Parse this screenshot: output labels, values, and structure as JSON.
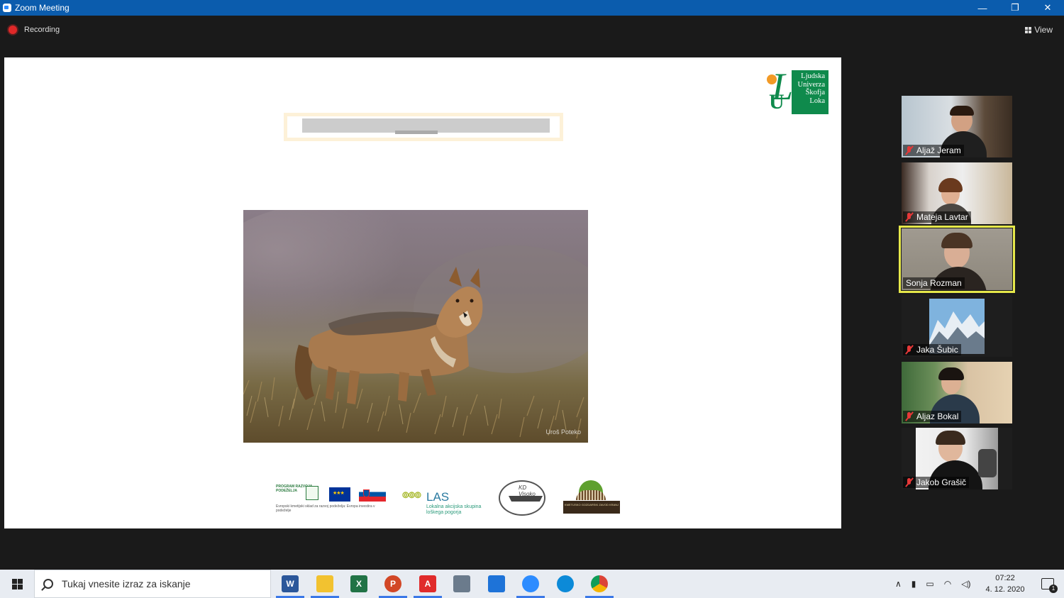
{
  "window": {
    "title": "Zoom Meeting",
    "controls": [
      "minimize-icon",
      "maximize-icon",
      "close-icon"
    ]
  },
  "meeting": {
    "recording_label": "Recording",
    "view_label": "View"
  },
  "slide": {
    "university_logo_lines": [
      "Ljudska",
      "Univerza",
      "Škofja",
      "Loka"
    ],
    "photo_credit": "Uroš Poteko",
    "partner_logos": [
      {
        "name": "program-razvoja-podezelja-logo",
        "text": "PROGRAM RAZVOJA PODEŽELJA"
      },
      {
        "name": "program-razvoja-subtitle",
        "text": "Evropski kmetijski sklad za razvoj podeželja: Evropa investira v podeželje"
      },
      {
        "name": "las-logo",
        "text": "LAS"
      },
      {
        "name": "las-subtitle",
        "text": "Lokalna akcijska skupina loškega pogorja"
      },
      {
        "name": "kd-logo",
        "text": "KD Visoko"
      },
      {
        "name": "kgz-logo",
        "text": "KMETIJSKO GOZDARSKI ZAVOD KRANJ"
      }
    ]
  },
  "participants": [
    {
      "name": "Aljaž Jeram",
      "muted": true,
      "active": false
    },
    {
      "name": "Mateja Lavtar",
      "muted": true,
      "active": false
    },
    {
      "name": "Sonja Rozman",
      "muted": false,
      "active": true
    },
    {
      "name": "Jaka Šubic",
      "muted": true,
      "active": false
    },
    {
      "name": "Aljaz Bokal",
      "muted": true,
      "active": false
    },
    {
      "name": "Jakob Grašič",
      "muted": true,
      "active": false
    }
  ],
  "taskbar": {
    "search_placeholder": "Tukaj vnesite izraz za iskanje",
    "apps": [
      {
        "name": "word-icon",
        "letter": "W",
        "color": "#2b579a"
      },
      {
        "name": "file-explorer-icon",
        "letter": "",
        "color": "#f2c230"
      },
      {
        "name": "excel-icon",
        "letter": "X",
        "color": "#217346"
      },
      {
        "name": "powerpoint-icon",
        "letter": "P",
        "color": "#d24726"
      },
      {
        "name": "acrobat-icon",
        "letter": "A",
        "color": "#e02b2b"
      },
      {
        "name": "calculator-icon",
        "letter": "",
        "color": "#6b7b8c"
      },
      {
        "name": "calendar-icon",
        "letter": "",
        "color": "#1e73d8"
      },
      {
        "name": "zoom-icon",
        "letter": "",
        "color": "#2d8cff"
      },
      {
        "name": "edge-icon",
        "letter": "",
        "color": "#0c8ad8"
      },
      {
        "name": "chrome-icon",
        "letter": "",
        "color": "#db4437"
      }
    ],
    "time": "07:22",
    "date": "4. 12. 2020",
    "notification_count": "1"
  }
}
